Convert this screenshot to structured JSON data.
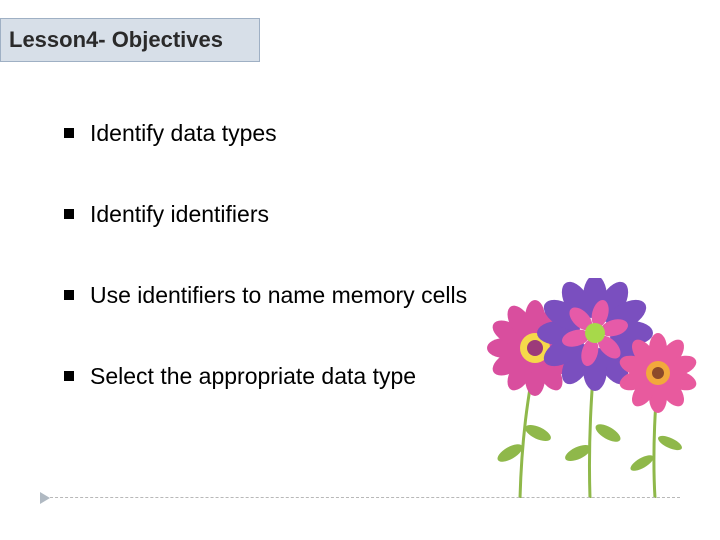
{
  "title": "Lesson4- Objectives",
  "bullets": [
    "Identify data types",
    "Identify identifiers",
    "Use identifiers to name memory cells",
    "Select the appropriate data type"
  ]
}
